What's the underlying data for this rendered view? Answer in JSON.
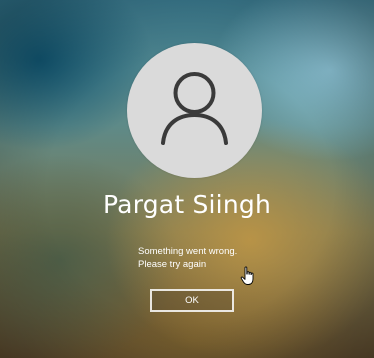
{
  "user": {
    "name": "Pargat Siingh",
    "avatar_icon": "user-silhouette-icon"
  },
  "error": {
    "line1": "Something went wrong.",
    "line2": "Please try again"
  },
  "actions": {
    "ok_label": "OK"
  },
  "pointer": {
    "icon": "hand-pointer-icon"
  },
  "colors": {
    "text": "#ffffff",
    "avatar_bg": "#dadada",
    "avatar_glyph": "#3a3a3a"
  }
}
